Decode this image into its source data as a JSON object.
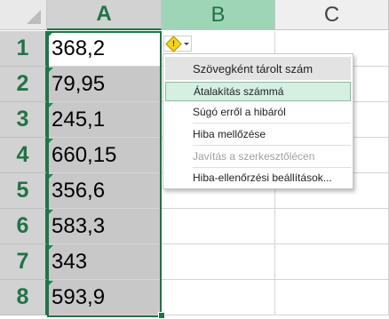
{
  "columns": [
    {
      "label": "A",
      "state": "selected"
    },
    {
      "label": "B",
      "state": "highlight"
    },
    {
      "label": "C",
      "state": "normal"
    }
  ],
  "rows": [
    {
      "num": "1",
      "a": "368,2"
    },
    {
      "num": "2",
      "a": "79,95"
    },
    {
      "num": "3",
      "a": "245,1"
    },
    {
      "num": "4",
      "a": "660,15"
    },
    {
      "num": "5",
      "a": "356,6"
    },
    {
      "num": "6",
      "a": "583,3"
    },
    {
      "num": "7",
      "a": "343"
    },
    {
      "num": "8",
      "a": "593,9"
    }
  ],
  "error_button": {
    "icon": "warning-diamond-icon",
    "glyph": "!"
  },
  "menu": {
    "header": "Szövegként tárolt szám",
    "items": [
      {
        "label": "Átalakítás számmá",
        "state": "hover"
      },
      {
        "label": "Súgó erről a hibáról",
        "state": "normal"
      },
      {
        "label": "Hiba mellőzése",
        "state": "normal"
      },
      {
        "label": "Javítás a szerkesztőlécen",
        "state": "disabled"
      },
      {
        "label": "Hiba-ellenőrzési beállítások...",
        "state": "normal"
      }
    ]
  },
  "colors": {
    "accent": "#217346",
    "selection": "#c8c8c8",
    "hover": "#d3f0e0"
  }
}
